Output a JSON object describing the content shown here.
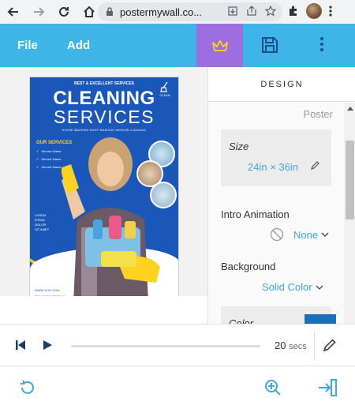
{
  "browser": {
    "url": "postermywall.co..."
  },
  "header": {
    "file_label": "File",
    "add_label": "Add"
  },
  "poster": {
    "tagline": "BEST & EXCELLENT SERVICES",
    "title_line1": "CLEANING",
    "title_line2": "SERVICES",
    "tags": "HOUSE WASHING  ROOF WASHING  WINDOW CLEANING",
    "services_heading": "OUR SERVICES",
    "services": [
      "Service Name",
      "Service Name",
      "Service Name"
    ],
    "logo_text": "CLEAN",
    "contact": [
      "LOREM",
      "IPSUM",
      "DOLOR",
      "SIT AMET"
    ],
    "url_text": "WWW.SITE.COM",
    "footer_text": "Made with PosterMyWall.com"
  },
  "design_panel": {
    "tab_label": "DESIGN",
    "poster_label": "Poster",
    "size_label": "Size",
    "size_value": "24in × 36in",
    "intro_animation_label": "Intro Animation",
    "intro_animation_value": "None",
    "background_label": "Background",
    "background_value": "Solid Color",
    "color_label": "Color",
    "color_value": "#1a6fb8"
  },
  "timeline": {
    "duration_value": "20",
    "duration_unit": "secs"
  },
  "colors": {
    "header_bg": "#3fb4e6",
    "premium_bg": "#9c6ee0",
    "accent_link": "#3fa8d8"
  }
}
